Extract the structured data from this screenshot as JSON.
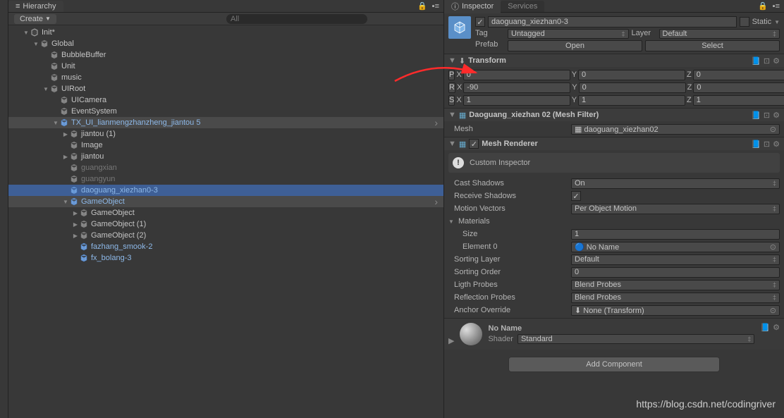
{
  "hierarchy": {
    "tab": "Hierarchy",
    "create": "Create",
    "search_placeholder": "All",
    "scene": "Init*",
    "tree": [
      {
        "d": 1,
        "exp": "down",
        "icon": "scene",
        "name": "Init*"
      },
      {
        "d": 2,
        "exp": "down",
        "icon": "cube",
        "name": "Global"
      },
      {
        "d": 3,
        "exp": "none",
        "icon": "cube",
        "name": "BubbleBuffer"
      },
      {
        "d": 3,
        "exp": "none",
        "icon": "cube",
        "name": "Unit"
      },
      {
        "d": 3,
        "exp": "none",
        "icon": "cube",
        "name": "music"
      },
      {
        "d": 3,
        "exp": "down",
        "icon": "cube",
        "name": "UIRoot"
      },
      {
        "d": 4,
        "exp": "none",
        "icon": "cube",
        "name": "UICamera"
      },
      {
        "d": 4,
        "exp": "none",
        "icon": "cube",
        "name": "EventSystem"
      },
      {
        "d": 4,
        "exp": "down",
        "icon": "prefab",
        "name": "TX_UI_lianmengzhanzheng_jiantou 5",
        "sel": "hl",
        "arrow": true
      },
      {
        "d": 5,
        "exp": "right",
        "icon": "cube",
        "name": "jiantou (1)"
      },
      {
        "d": 5,
        "exp": "none",
        "icon": "cube",
        "name": "Image"
      },
      {
        "d": 5,
        "exp": "right",
        "icon": "cube",
        "name": "jiantou"
      },
      {
        "d": 5,
        "exp": "none",
        "icon": "cube",
        "name": "guangxian",
        "dim": true
      },
      {
        "d": 5,
        "exp": "none",
        "icon": "cube",
        "name": "guangyun",
        "dim": true
      },
      {
        "d": 5,
        "exp": "none",
        "icon": "prefab",
        "name": "daoguang_xiezhan0-3",
        "sel": "selected"
      },
      {
        "d": 5,
        "exp": "down",
        "icon": "prefab",
        "name": "GameObject",
        "sel": "hl",
        "arrow": true
      },
      {
        "d": 6,
        "exp": "right",
        "icon": "cube",
        "name": "GameObject"
      },
      {
        "d": 6,
        "exp": "right",
        "icon": "cube",
        "name": "GameObject (1)"
      },
      {
        "d": 6,
        "exp": "right",
        "icon": "cube",
        "name": "GameObject (2)"
      },
      {
        "d": 6,
        "exp": "none",
        "icon": "prefab",
        "name": "fazhang_smook-2"
      },
      {
        "d": 6,
        "exp": "none",
        "icon": "prefab",
        "name": "fx_bolang-3"
      }
    ]
  },
  "inspector": {
    "tab1": "Inspector",
    "tab2": "Services",
    "gameobject": {
      "enabled": true,
      "name": "daoguang_xiezhan0-3",
      "static_label": "Static",
      "tag_label": "Tag",
      "tag_value": "Untagged",
      "layer_label": "Layer",
      "layer_value": "Default",
      "prefab_label": "Prefab",
      "open_btn": "Open",
      "select_btn": "Select"
    },
    "transform": {
      "title": "Transform",
      "p": "P",
      "r": "R",
      "s": "S",
      "px": "0",
      "py": "0",
      "pz": "0",
      "rx": "-90",
      "ry": "0",
      "rz": "0",
      "sx": "1",
      "sy": "1",
      "sz": "1"
    },
    "meshfilter": {
      "title": "Daoguang_xiezhan 02 (Mesh Filter)",
      "mesh_label": "Mesh",
      "mesh_value": "daoguang_xiezhan02"
    },
    "meshrenderer": {
      "title": "Mesh Renderer",
      "custom": "Custom Inspector",
      "props": {
        "cast_shadows_l": "Cast Shadows",
        "cast_shadows_v": "On",
        "receive_shadows_l": "Receive Shadows",
        "motion_l": "Motion Vectors",
        "motion_v": "Per Object Motion",
        "materials_l": "Materials",
        "size_l": "Size",
        "size_v": "1",
        "elem_l": "Element 0",
        "elem_v": "No Name",
        "sorting_layer_l": "Sorting Layer",
        "sorting_layer_v": "Default",
        "sorting_order_l": "Sorting Order",
        "sorting_order_v": "0",
        "light_probes_l": "Ligth Probes",
        "light_probes_v": "Blend Probes",
        "reflection_l": "Reflection Probes",
        "reflection_v": "Blend Probes",
        "anchor_l": "Anchor Override",
        "anchor_v": "None (Transform)"
      }
    },
    "material": {
      "name": "No Name",
      "shader_l": "Shader",
      "shader_v": "Standard"
    },
    "add_component": "Add Component"
  },
  "watermark": "https://blog.csdn.net/codingriver"
}
